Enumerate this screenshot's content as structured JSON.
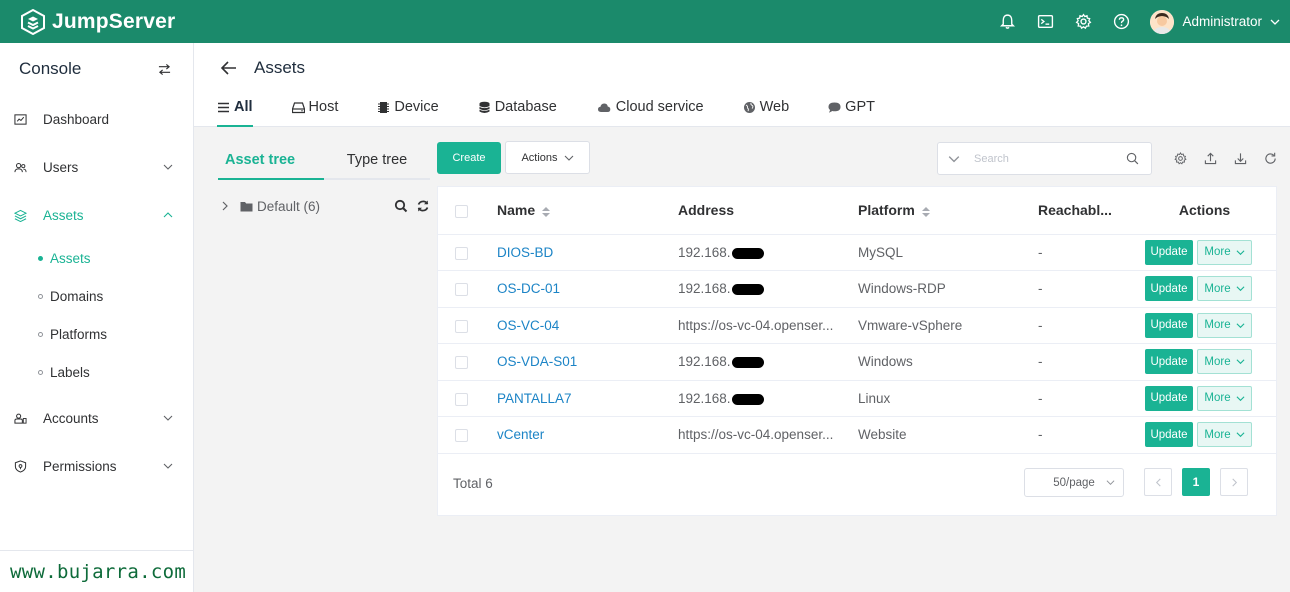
{
  "brand": {
    "name": "JumpServer"
  },
  "header": {
    "user_name": "Administrator"
  },
  "sidebar": {
    "console_title": "Console",
    "items": [
      {
        "label": "Dashboard"
      },
      {
        "label": "Users"
      },
      {
        "label": "Assets"
      },
      {
        "label": "Accounts"
      },
      {
        "label": "Permissions"
      }
    ],
    "sub_items": [
      {
        "label": "Assets"
      },
      {
        "label": "Domains"
      },
      {
        "label": "Platforms"
      },
      {
        "label": "Labels"
      }
    ],
    "watermark": "www.bujarra.com"
  },
  "page": {
    "title": "Assets",
    "tabs": [
      {
        "label": "All"
      },
      {
        "label": "Host"
      },
      {
        "label": "Device"
      },
      {
        "label": "Database"
      },
      {
        "label": "Cloud service"
      },
      {
        "label": "Web"
      },
      {
        "label": "GPT"
      }
    ]
  },
  "tree": {
    "tabs": [
      {
        "label": "Asset tree"
      },
      {
        "label": "Type tree"
      }
    ],
    "root_label": "Default (6)"
  },
  "toolbar": {
    "create_label": "Create",
    "actions_label": "Actions",
    "search_placeholder": "Search"
  },
  "table": {
    "columns": [
      "Name",
      "Address",
      "Platform",
      "Reachabl...",
      "Actions"
    ],
    "rows": [
      {
        "name": "DIOS-BD",
        "address": "192.168.",
        "redacted": true,
        "platform": "MySQL",
        "reachable": "-"
      },
      {
        "name": "OS-DC-01",
        "address": "192.168.",
        "redacted": true,
        "platform": "Windows-RDP",
        "reachable": "-"
      },
      {
        "name": "OS-VC-04",
        "address": "https://os-vc-04.openser...",
        "redacted": false,
        "platform": "Vmware-vSphere",
        "reachable": "-"
      },
      {
        "name": "OS-VDA-S01",
        "address": "192.168.",
        "redacted": true,
        "platform": "Windows",
        "reachable": "-"
      },
      {
        "name": "PANTALLA7",
        "address": "192.168.",
        "redacted": true,
        "platform": "Linux",
        "reachable": "-"
      },
      {
        "name": "vCenter",
        "address": "https://os-vc-04.openser...",
        "redacted": false,
        "platform": "Website",
        "reachable": "-"
      }
    ],
    "update_label": "Update",
    "more_label": "More"
  },
  "pagination": {
    "total": "Total 6",
    "page_size": "50/page",
    "current_page": "1"
  },
  "colors": {
    "header": "#1b8a6b",
    "accent": "#1ab394",
    "link": "#1c84c6"
  }
}
